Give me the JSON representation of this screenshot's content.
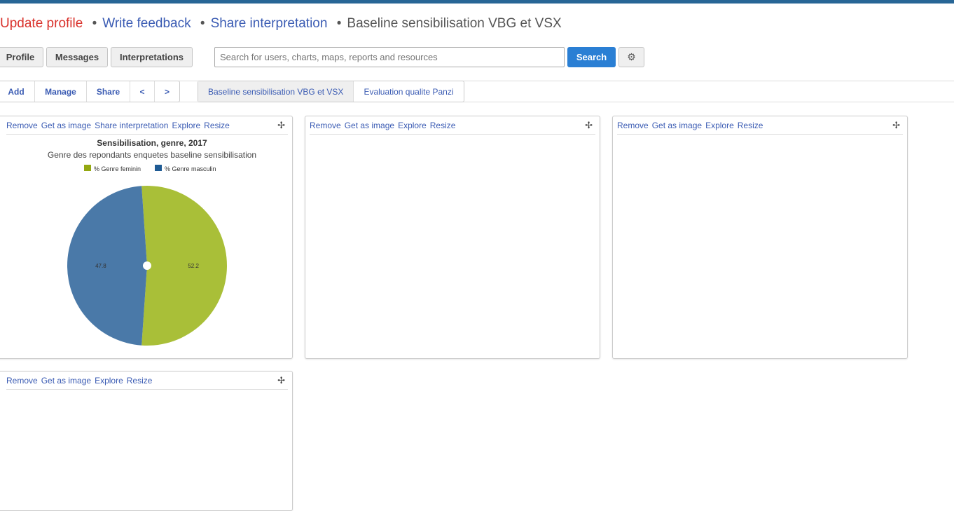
{
  "header": {
    "update_profile": "Update profile",
    "write_feedback": "Write feedback",
    "share_interpretation": "Share interpretation",
    "dashboard_title": "Baseline sensibilisation VBG et VSX",
    "sep": "•"
  },
  "nav": {
    "profile": "Profile",
    "messages": "Messages",
    "interpretations": "Interpretations",
    "search_placeholder": "Search for users, charts, maps, reports and resources",
    "search_button": "Search",
    "settings_icon": "⚙"
  },
  "toolbar": {
    "add": "Add",
    "manage": "Manage",
    "share": "Share",
    "prev": "<",
    "next": ">"
  },
  "dashboards": [
    {
      "label": "Baseline sensibilisation VBG et VSX",
      "active": true
    },
    {
      "label": "Evaluation qualite Panzi",
      "active": false
    }
  ],
  "items": [
    {
      "links": [
        "Remove",
        "Get as image",
        "Share interpretation",
        "Explore",
        "Resize"
      ]
    },
    {
      "links": [
        "Remove",
        "Get as image",
        "Explore",
        "Resize"
      ]
    },
    {
      "links": [
        "Remove",
        "Get as image",
        "Explore",
        "Resize"
      ]
    },
    {
      "links": [
        "Remove",
        "Get as image",
        "Explore",
        "Resize"
      ]
    }
  ],
  "move_icon": "✢",
  "chart_data": {
    "type": "pie",
    "title": "Sensibilisation, genre, 2017",
    "subtitle": "Genre des repondants enquetes baseline sensibilisation",
    "legend_position": "top",
    "series": [
      {
        "name": "% Genre feminin",
        "value": 52.2,
        "label": "52.2",
        "color": "#a9bf38"
      },
      {
        "name": "% Genre masculin",
        "value": 47.8,
        "label": "47.8",
        "color": "#4a79a8"
      }
    ],
    "legend_colors": [
      "#94a811",
      "#1f5b94"
    ]
  }
}
